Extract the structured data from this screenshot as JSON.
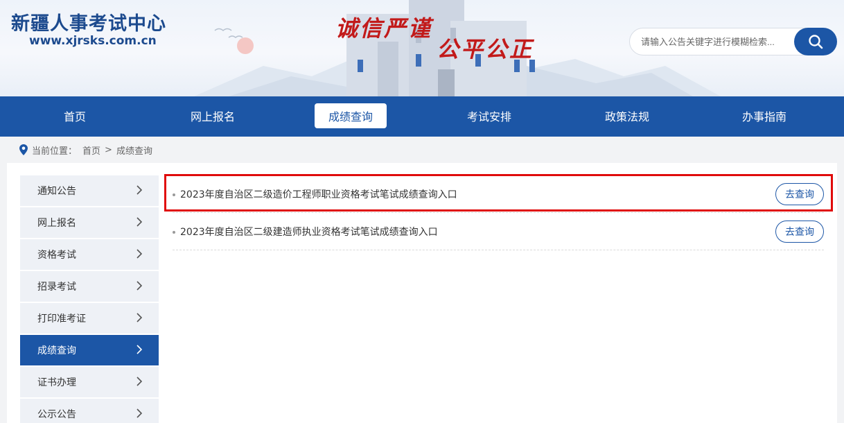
{
  "header": {
    "site_title": "新疆人事考试中心",
    "site_url": "www.xjrsks.com.cn",
    "slogan_left": "诚信严谨",
    "slogan_right": "公平公正",
    "search_placeholder": "请输入公告关键字进行模糊检索..."
  },
  "nav": {
    "items": [
      {
        "label": "首页"
      },
      {
        "label": "网上报名"
      },
      {
        "label": "成绩查询"
      },
      {
        "label": "考试安排"
      },
      {
        "label": "政策法规"
      },
      {
        "label": "办事指南"
      }
    ],
    "active": "成绩查询"
  },
  "breadcrumb": {
    "prefix": "当前位置：",
    "home": "首页",
    "separator": ">",
    "current": "成绩查询"
  },
  "sidebar": {
    "items": [
      {
        "label": "通知公告"
      },
      {
        "label": "网上报名"
      },
      {
        "label": "资格考试"
      },
      {
        "label": "招录考试"
      },
      {
        "label": "打印准考证"
      },
      {
        "label": "成绩查询"
      },
      {
        "label": "证书办理"
      },
      {
        "label": "公示公告"
      }
    ],
    "active": "成绩查询"
  },
  "list": {
    "items": [
      {
        "title": "2023年度自治区二级造价工程师职业资格考试笔试成绩查询入口",
        "button": "去查询"
      },
      {
        "title": "2023年度自治区二级建造师执业资格考试笔试成绩查询入口",
        "button": "去查询"
      }
    ]
  },
  "colors": {
    "primary": "#1c56a6",
    "slogan": "#c21a1a",
    "highlight": "#e00b0b"
  }
}
